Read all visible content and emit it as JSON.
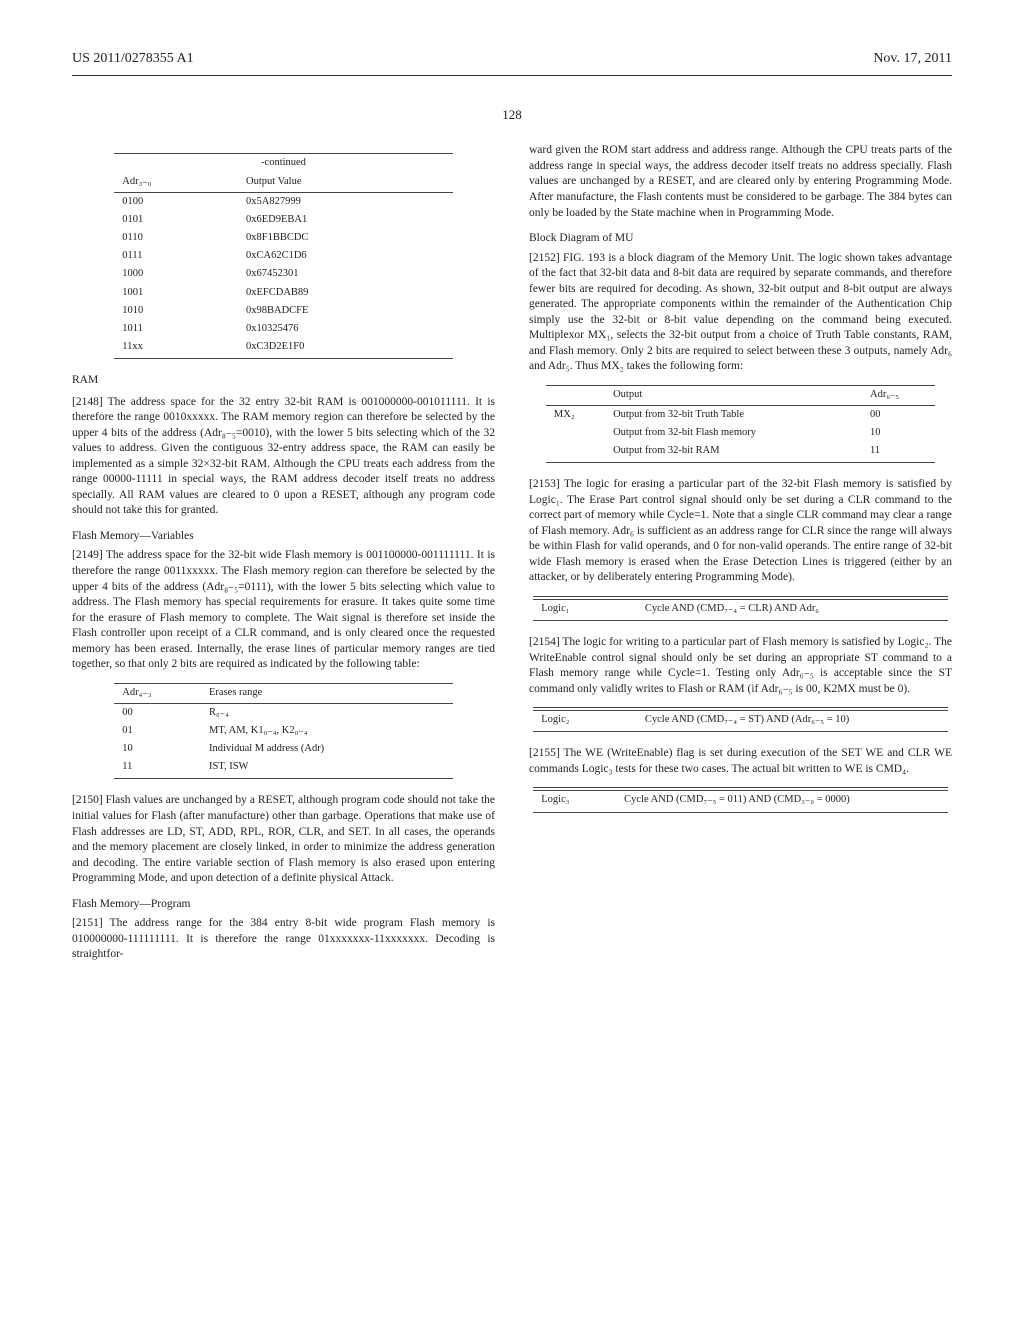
{
  "header": {
    "left": "US 2011/0278355 A1",
    "right": "Nov. 17, 2011"
  },
  "pagenum": "128",
  "col1": {
    "table1": {
      "caption": "-continued",
      "h1": "Adr₃₋₀",
      "h2": "Output Value",
      "rows": [
        [
          "0100",
          "0x5A827999"
        ],
        [
          "0101",
          "0x6ED9EBA1"
        ],
        [
          "0110",
          "0x8F1BBCDC"
        ],
        [
          "0111",
          "0xCA62C1D6"
        ],
        [
          "1000",
          "0x67452301"
        ],
        [
          "1001",
          "0xEFCDAB89"
        ],
        [
          "1010",
          "0x98BADCFE"
        ],
        [
          "1011",
          "0x10325476"
        ],
        [
          "11xx",
          "0xC3D2E1F0"
        ]
      ]
    },
    "h_ram": "RAM",
    "p2148": "[2148]  The address space for the 32 entry 32-bit RAM is 001000000-001011111. It is therefore the range 0010xxxxx. The RAM memory region can therefore be selected by the upper 4 bits of the address (Adr₈₋₅=0010), with the lower 5 bits selecting which of the 32 values to address. Given the contiguous 32-entry address space, the RAM can easily be implemented as a simple 32×32-bit RAM. Although the CPU treats each address from the range 00000-11111 in special ways, the RAM address decoder itself treats no address specially. All RAM values are cleared to 0 upon a RESET, although any program code should not take this for granted.",
    "h_flashvar": "Flash Memory—Variables",
    "p2149": "[2149]  The address space for the 32-bit wide Flash memory is 001100000-001111111. It is therefore the range 0011xxxxx. The Flash memory region can therefore be selected by the upper 4 bits of the address (Adr₈₋₅=0111), with the lower 5 bits selecting which value to address. The Flash memory has special requirements for erasure. It takes quite some time for the erasure of Flash memory to complete. The Wait signal is therefore set inside the Flash controller upon receipt of a CLR command, and is only cleared once the requested memory has been erased. Internally, the erase lines of particular memory ranges are tied together, so that only 2 bits are required as indicated by the following table:",
    "table2": {
      "h1": "Adr₄₋₃",
      "h2": "Erases range",
      "rows": [
        [
          "00",
          "R₀₋₄"
        ],
        [
          "01",
          "MT, AM, K1₀₋₄, K2₀₋₄"
        ],
        [
          "10",
          "Individual M address (Adr)"
        ],
        [
          "11",
          "IST, ISW"
        ]
      ]
    },
    "p2150": "[2150]  Flash values are unchanged by a RESET, although program code should not take the initial values for Flash (after manufacture) other than garbage. Operations that make use of Flash addresses are LD, ST, ADD, RPL, ROR, CLR, and SET. In all cases, the operands and the memory placement are closely linked, in order to minimize the address generation and decoding. The entire variable section of Flash memory is also erased upon entering Programming Mode, and upon detection of a definite physical Attack.",
    "h_flashprog": "Flash Memory—Program",
    "p2151": "[2151]  The address range for the 384 entry 8-bit wide program Flash memory is 010000000-111111111. It is therefore the range 01xxxxxxx-11xxxxxxx. Decoding is straightfor-"
  },
  "col2": {
    "pCont": "ward given the ROM start address and address range. Although the CPU treats parts of the address range in special ways, the address decoder itself treats no address specially. Flash values are unchanged by a RESET, and are cleared only by entering Programming Mode. After manufacture, the Flash contents must be considered to be garbage. The 384 bytes can only be loaded by the State machine when in Programming Mode.",
    "h_block": "Block Diagram of MU",
    "p2152": "[2152]  FIG. 193 is a block diagram of the Memory Unit. The logic shown takes advantage of the fact that 32-bit data and 8-bit data are required by separate commands, and therefore fewer bits are required for decoding. As shown, 32-bit output and 8-bit output are always generated. The appropriate components within the remainder of the Authentication Chip simply use the 32-bit or 8-bit value depending on the command being executed. Multiplexor MX₁, selects the 32-bit output from a choice of Truth Table constants, RAM, and Flash memory. Only 2 bits are required to select between these 3 outputs, namely Adr₆ and Adr₅. Thus MX₂ takes the following form:",
    "table3": {
      "h1": "",
      "h2": "Output",
      "h3": "Adr₆₋₅",
      "rows": [
        [
          "MX₂",
          "Output from 32-bit Truth Table",
          "00"
        ],
        [
          "",
          "Output from 32-bit Flash memory",
          "10"
        ],
        [
          "",
          "Output from 32-bit RAM",
          "11"
        ]
      ]
    },
    "p2153": "[2153]  The logic for erasing a particular part of the 32-bit Flash memory is satisfied by Logic₁. The Erase Part control signal should only be set during a CLR command to the correct part of memory while Cycle=1. Note that a single CLR command may clear a range of Flash memory. Adr₆ is sufficient as an address range for CLR since the range will always be within Flash for valid operands, and 0 for non-valid operands. The entire range of 32-bit wide Flash memory is erased when the Erase Detection Lines is triggered (either by an attacker, or by deliberately entering Programming Mode).",
    "logic1": {
      "l": "Logic₁",
      "r": "Cycle AND (CMD₇₋₄ = CLR) AND Adr₆"
    },
    "p2154": "[2154]  The logic for writing to a particular part of Flash memory is satisfied by Logic₂. The WriteEnable control signal should only be set during an appropriate ST command to a Flash memory range while Cycle=1. Testing only Adr₆₋₅ is acceptable since the ST command only validly writes to Flash or RAM (if Adr₆₋₅ is 00, K2MX must be 0).",
    "logic2": {
      "l": "Logic₂",
      "r": "Cycle AND (CMD₇₋₄ = ST) AND (Adr₆₋₅ = 10)"
    },
    "p2155": "[2155]  The WE (WriteEnable) flag is set during execution of the SET WE and CLR WE commands Logic₃ tests for these two cases. The actual bit written to WE is CMD₄.",
    "logic3": {
      "l": "Logic₃",
      "r": "Cycle AND (CMD₇₋₅ = 011) AND (CMD₃₋₀ = 0000)"
    }
  }
}
